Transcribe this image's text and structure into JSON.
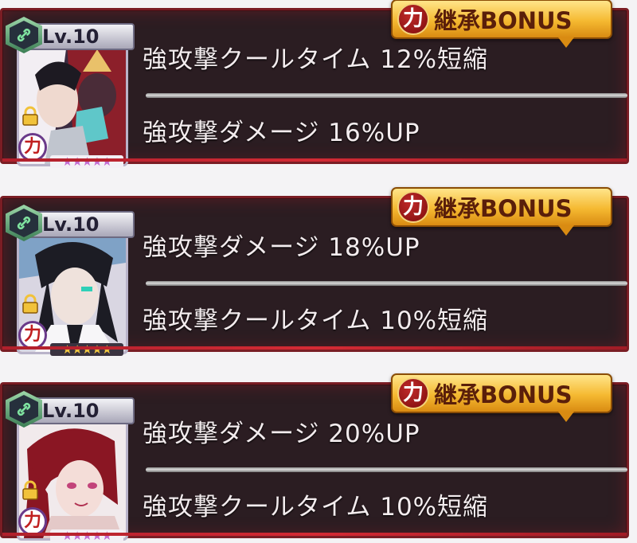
{
  "cards": [
    {
      "level": "Lv.10",
      "stats": [
        "強攻撃クールタイム 12%短縮",
        "強攻撃ダメージ 16%UP"
      ],
      "bonus_label": "継承BONUS",
      "power_glyph": "力",
      "stars": 5,
      "portrait_colors": [
        "#3b2b40",
        "#c7c1d6",
        "#8c1f2a"
      ]
    },
    {
      "level": "Lv.10",
      "stats": [
        "強攻撃ダメージ 18%UP",
        "強攻撃クールタイム 10%短縮"
      ],
      "bonus_label": "継承BONUS",
      "power_glyph": "力",
      "stars": 5,
      "portrait_colors": [
        "#1c1c24",
        "#d9d6e2",
        "#7fa2c6"
      ]
    },
    {
      "level": "Lv.10",
      "stats": [
        "強攻撃ダメージ 20%UP",
        "強攻撃クールタイム 10%短縮"
      ],
      "bonus_label": "継承BONUS",
      "power_glyph": "力",
      "stars": 5,
      "portrait_colors": [
        "#f1eaec",
        "#8a1623",
        "#e4c9c8"
      ]
    }
  ],
  "colors": {
    "card_bg": "#2b1d22",
    "card_border": "#7a1d24",
    "bonus_gold": "#f5b931",
    "bonus_text": "#5a1f0a",
    "star_purple": "#c26bd1"
  },
  "icons": {
    "link": "chain-link-icon",
    "lock": "padlock-icon",
    "power": "chikara-badge-icon",
    "star": "star-icon"
  }
}
